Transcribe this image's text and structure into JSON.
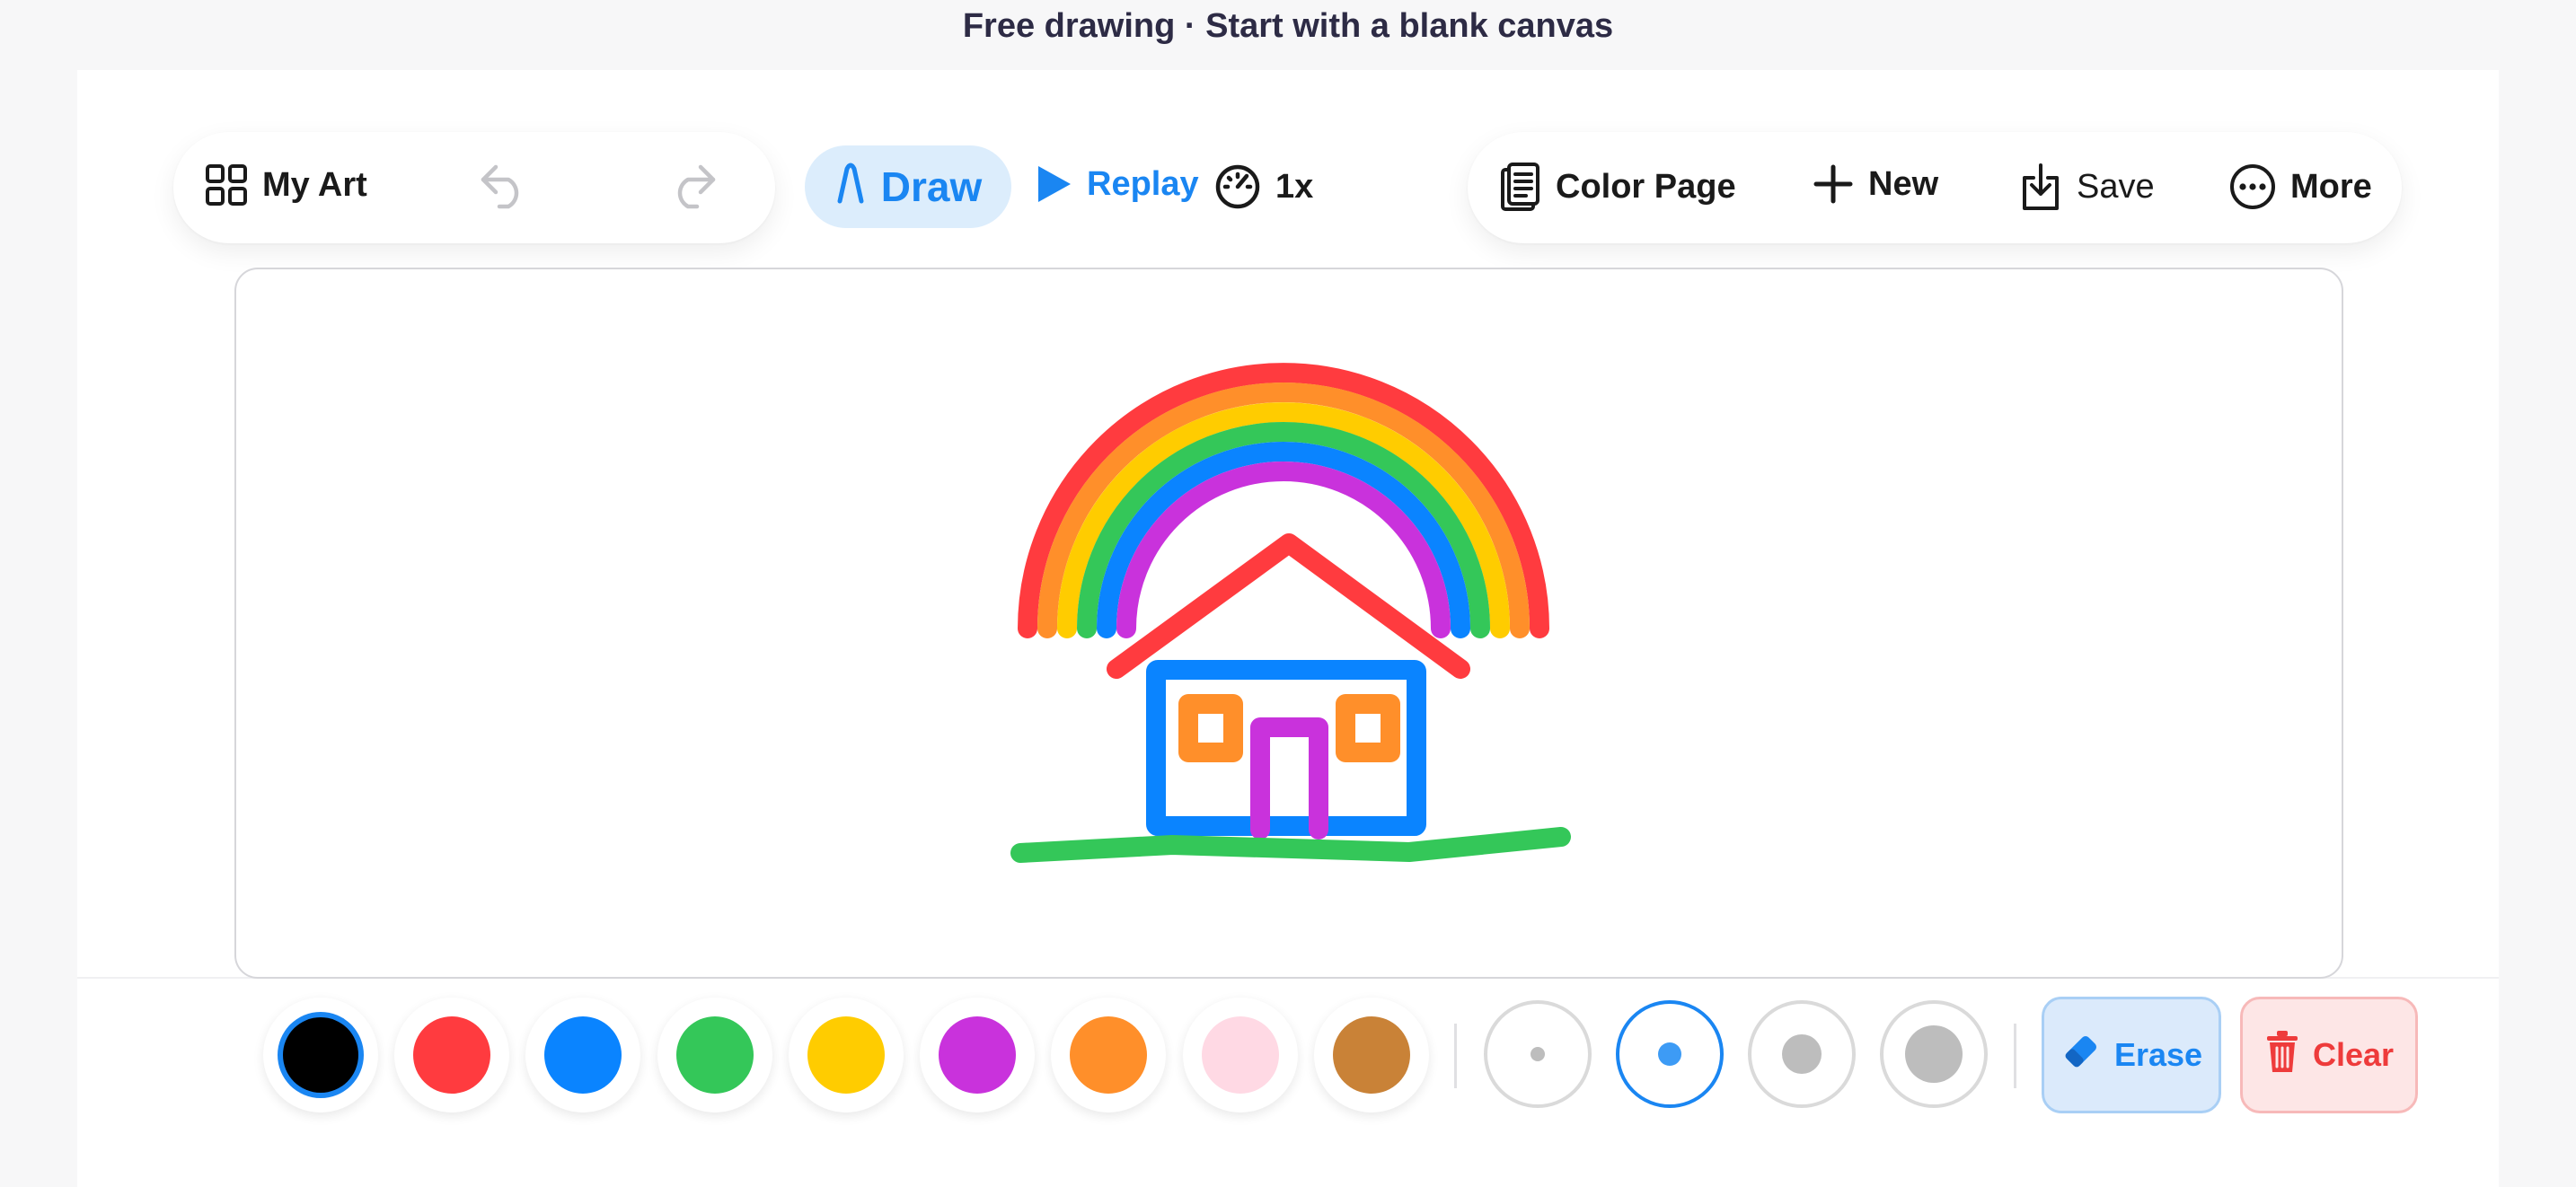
{
  "page_title": "Free drawing · Start with a blank canvas",
  "toolbar": {
    "my_art_label": "My Art",
    "draw_label": "Draw",
    "replay_label": "Replay",
    "speed_label": "1x",
    "color_page_label": "Color Page",
    "new_label": "New",
    "save_label": "Save",
    "more_label": "More",
    "undo_enabled": false,
    "redo_enabled": false
  },
  "palette": {
    "colors": [
      {
        "name": "black",
        "hex": "#000000",
        "selected": true
      },
      {
        "name": "red",
        "hex": "#ff3b3f",
        "selected": false
      },
      {
        "name": "blue",
        "hex": "#0a84ff",
        "selected": false
      },
      {
        "name": "green",
        "hex": "#34c759",
        "selected": false
      },
      {
        "name": "yellow",
        "hex": "#ffcc00",
        "selected": false
      },
      {
        "name": "purple",
        "hex": "#c932dc",
        "selected": false
      },
      {
        "name": "orange",
        "hex": "#ff8f2a",
        "selected": false
      },
      {
        "name": "pink",
        "hex": "#ffd9e4",
        "selected": false
      },
      {
        "name": "brown",
        "hex": "#c98237",
        "selected": false
      }
    ]
  },
  "brush_sizes": [
    {
      "name": "small",
      "selected": false
    },
    {
      "name": "medium",
      "selected": true
    },
    {
      "name": "large",
      "selected": false
    },
    {
      "name": "xlarge",
      "selected": false
    }
  ],
  "actions": {
    "erase_label": "Erase",
    "clear_label": "Clear"
  },
  "drawing": {
    "rainbow_colors": [
      "#ff3b3f",
      "#ff8f2a",
      "#ffcc00",
      "#34c759",
      "#0a84ff",
      "#c932dc"
    ],
    "roof_color": "#ff3b3f",
    "walls_color": "#0a84ff",
    "window_color": "#ff8f2a",
    "door_color": "#c932dc",
    "ground_color": "#34c759"
  },
  "colors": {
    "accent": "#1a86f2",
    "danger": "#ee3b3b"
  }
}
